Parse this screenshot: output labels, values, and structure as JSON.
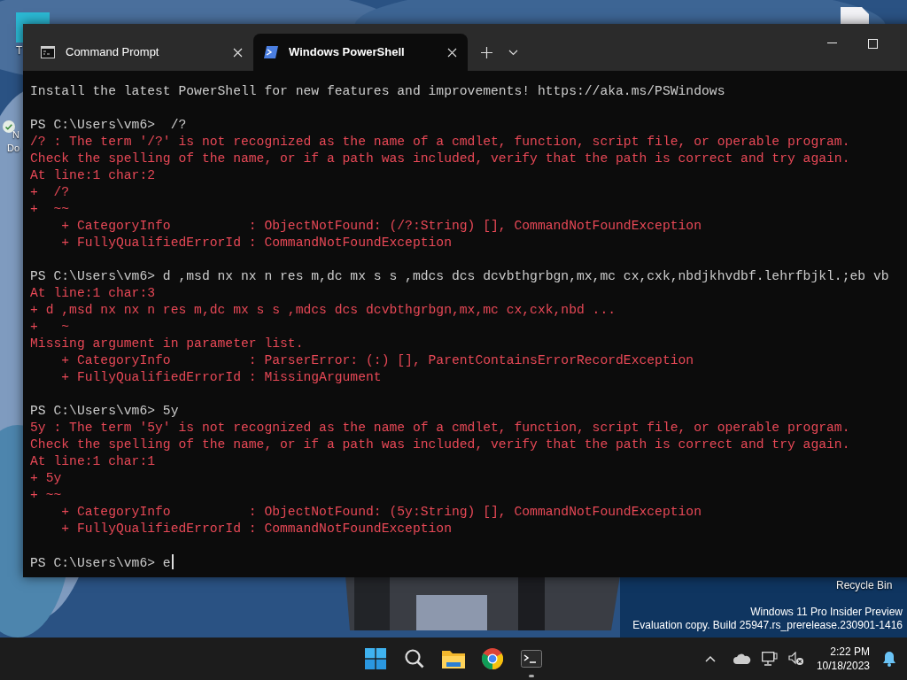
{
  "desktop": {
    "icons": [
      {
        "kind": "app",
        "label_lines": [
          "T"
        ]
      },
      {
        "kind": "synced",
        "label_lines": [
          "N",
          "Do"
        ]
      },
      {
        "kind": "file"
      },
      {
        "kind": "recycle",
        "label_lines": [
          "Recycle Bin"
        ]
      }
    ],
    "watermark": [
      "Windows 11 Pro Insider Preview",
      "Evaluation copy. Build 25947.rs_prerelease.230901-1416"
    ]
  },
  "terminal_window": {
    "tabs": [
      {
        "kind": "cmd",
        "label": "Command Prompt",
        "selected": false
      },
      {
        "kind": "powershell",
        "label": "Windows PowerShell",
        "selected": true
      }
    ],
    "lines": [
      {
        "kind": "info",
        "text": "Install the latest PowerShell for new features and improvements! https://aka.ms/PSWindows"
      },
      {
        "kind": "blank"
      },
      {
        "kind": "input",
        "text": "PS C:\\Users\\vm6>  /?"
      },
      {
        "kind": "error",
        "text": "/? : The term '/?' is not recognized as the name of a cmdlet, function, script file, or operable program."
      },
      {
        "kind": "error",
        "text": "Check the spelling of the name, or if a path was included, verify that the path is correct and try again."
      },
      {
        "kind": "error",
        "text": "At line:1 char:2"
      },
      {
        "kind": "error",
        "text": "+  /?"
      },
      {
        "kind": "error",
        "text": "+  ~~"
      },
      {
        "kind": "error",
        "text": "    + CategoryInfo          : ObjectNotFound: (/?:String) [], CommandNotFoundException"
      },
      {
        "kind": "error",
        "text": "    + FullyQualifiedErrorId : CommandNotFoundException"
      },
      {
        "kind": "blank"
      },
      {
        "kind": "input",
        "text": "PS C:\\Users\\vm6> d ,msd nx nx n res m,dc mx s s ,mdcs dcs dcvbthgrbgn,mx,mc cx,cxk,nbdjkhvdbf.lehrfbjkl.;eb vb"
      },
      {
        "kind": "error",
        "text": "At line:1 char:3"
      },
      {
        "kind": "error",
        "text": "+ d ,msd nx nx n res m,dc mx s s ,mdcs dcs dcvbthgrbgn,mx,mc cx,cxk,nbd ..."
      },
      {
        "kind": "error",
        "text": "+   ~"
      },
      {
        "kind": "error",
        "text": "Missing argument in parameter list."
      },
      {
        "kind": "error",
        "text": "    + CategoryInfo          : ParserError: (:) [], ParentContainsErrorRecordException"
      },
      {
        "kind": "error",
        "text": "    + FullyQualifiedErrorId : MissingArgument"
      },
      {
        "kind": "blank"
      },
      {
        "kind": "input",
        "text": "PS C:\\Users\\vm6> 5y"
      },
      {
        "kind": "error",
        "text": "5y : The term '5y' is not recognized as the name of a cmdlet, function, script file, or operable program."
      },
      {
        "kind": "error",
        "text": "Check the spelling of the name, or if a path was included, verify that the path is correct and try again."
      },
      {
        "kind": "error",
        "text": "At line:1 char:1"
      },
      {
        "kind": "error",
        "text": "+ 5y"
      },
      {
        "kind": "error",
        "text": "+ ~~"
      },
      {
        "kind": "error",
        "text": "    + CategoryInfo          : ObjectNotFound: (5y:String) [], CommandNotFoundException"
      },
      {
        "kind": "error",
        "text": "    + FullyQualifiedErrorId : CommandNotFoundException"
      },
      {
        "kind": "blank"
      },
      {
        "kind": "input",
        "text": "PS C:\\Users\\vm6> e",
        "cursor": true
      }
    ]
  },
  "taskbar": {
    "apps": [
      {
        "kind": "start",
        "running": false
      },
      {
        "kind": "search",
        "running": false
      },
      {
        "kind": "folder",
        "running": false
      },
      {
        "kind": "browser",
        "running": false
      },
      {
        "kind": "terminal",
        "running": true
      }
    ],
    "clock": {
      "time": "2:22 PM",
      "date": "10/18/2023"
    }
  }
}
